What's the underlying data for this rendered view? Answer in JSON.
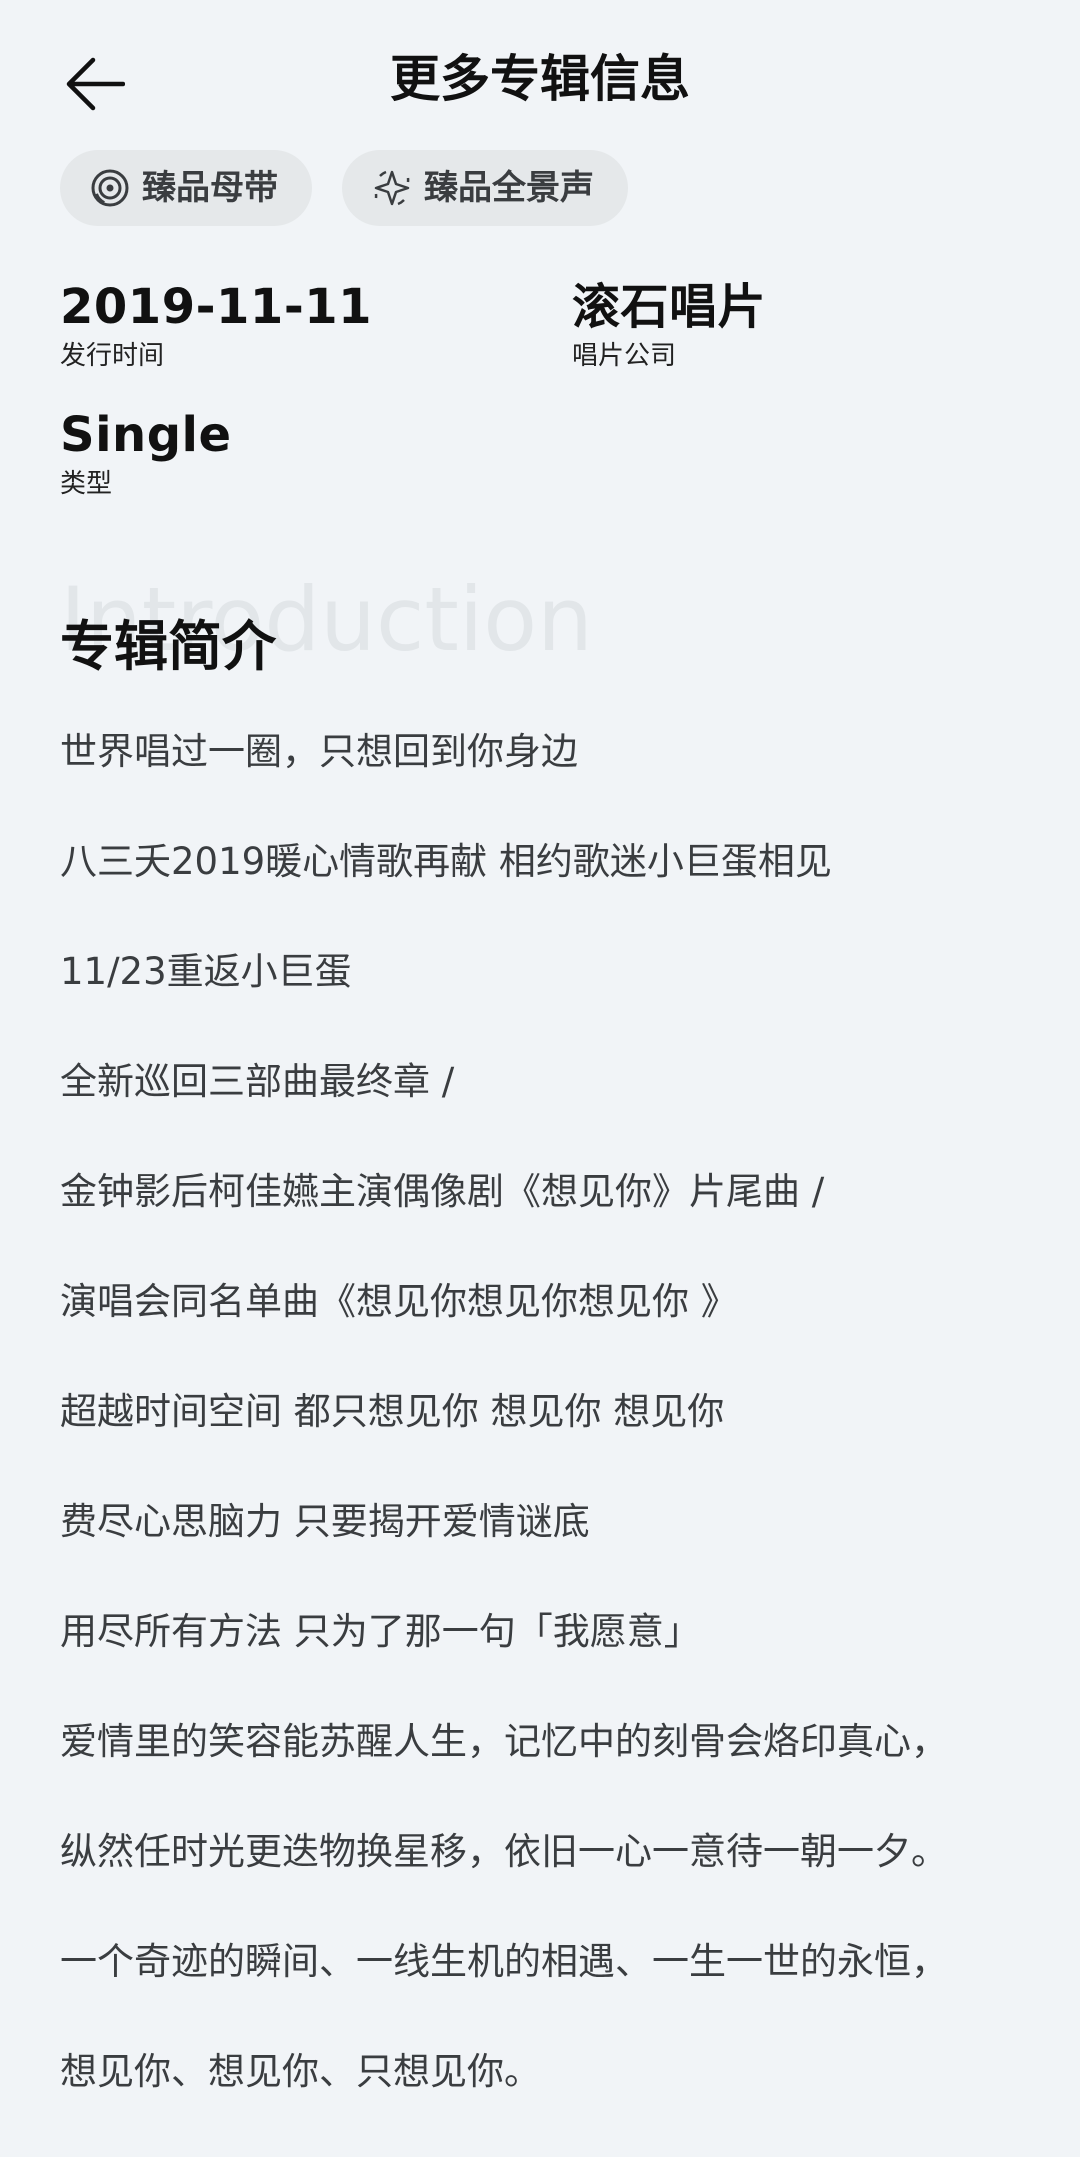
{
  "header": {
    "title": "更多专辑信息",
    "back_icon": "arrow-left-icon"
  },
  "badges": [
    {
      "icon": "master-tape-icon",
      "label": "臻品母带"
    },
    {
      "icon": "panoramic-sound-icon",
      "label": "臻品全景声"
    }
  ],
  "info": {
    "release_date": {
      "value": "2019-11-11",
      "label": "发行时间"
    },
    "label_company": {
      "value": "滚石唱片",
      "label": "唱片公司"
    },
    "type": {
      "value": "Single",
      "label": "类型"
    }
  },
  "intro": {
    "watermark": "Introduction",
    "title": "专辑简介",
    "lines": [
      "世界唱过一圈，只想回到你身边",
      "八三夭2019暖心情歌再献 相约歌迷小巨蛋相见",
      "11/23重返小巨蛋",
      "全新巡回三部曲最终章 /",
      "金钟影后柯佳嬿主演偶像剧《想见你》片尾曲 /",
      "演唱会同名单曲《想见你想见你想见你 》",
      "超越时间空间 都只想见你 想见你 想见你",
      "费尽心思脑力 只要揭开爱情谜底",
      "用尽所有方法 只为了那一句「我愿意」",
      "爱情里的笑容能苏醒人生，记忆中的刻骨会烙印真心，",
      "纵然任时光更迭物换星移，依旧一心一意待一朝一夕。",
      "一个奇迹的瞬间、一线生机的相遇、一生一世的永恒，",
      "想见你、想见你、只想见你。"
    ]
  },
  "colors": {
    "background": "#f1f4f7",
    "badge_bg": "#e5e8ea",
    "text_primary": "#111111",
    "text_secondary": "#3a3d40",
    "watermark": "#e2e6e9"
  }
}
